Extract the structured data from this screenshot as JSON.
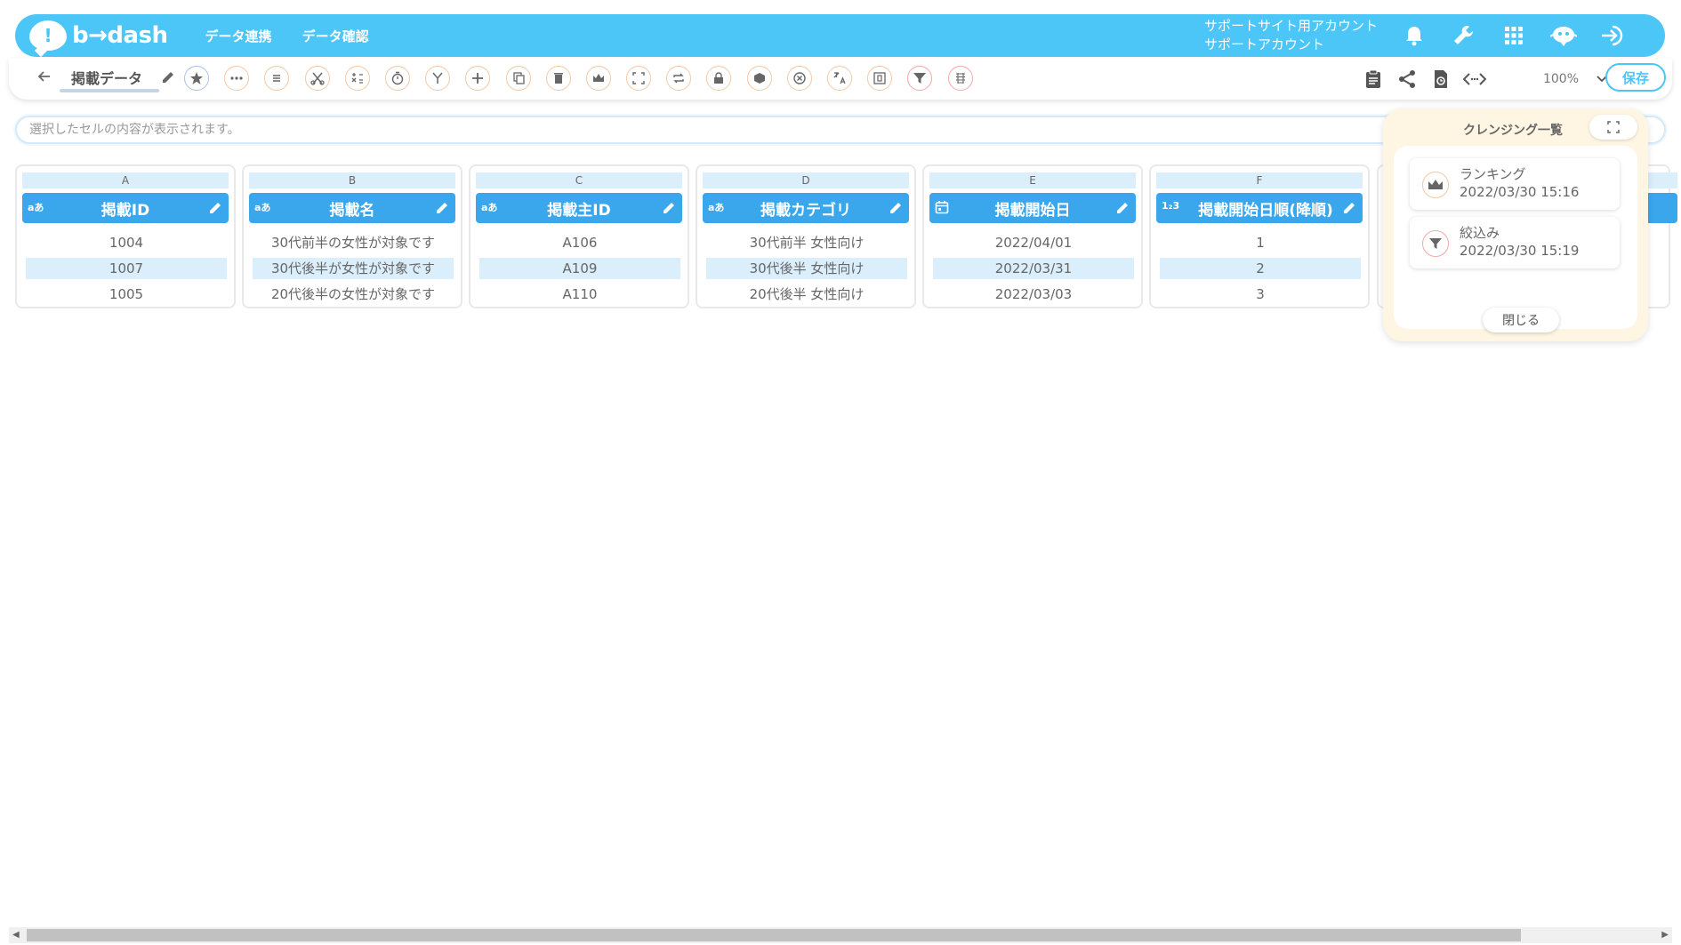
{
  "header": {
    "logo_text": "b→dash",
    "nav": [
      "データ連携",
      "データ確認"
    ],
    "account_line1": "サポートサイト用アカウント",
    "account_line2": "サポートアカウント",
    "icons": [
      "bell-icon",
      "wrench-icon",
      "grid-icon",
      "bot-icon",
      "logout-icon"
    ]
  },
  "toolbar": {
    "sheet_name": "掲載データ",
    "tools": [
      "star",
      "more",
      "list",
      "cut",
      "calc",
      "timer",
      "branch",
      "add",
      "copy",
      "delete",
      "ranking",
      "fullscreen",
      "repeat",
      "lock",
      "box",
      "close-circle",
      "translate",
      "frame",
      "filter",
      "pattern"
    ],
    "zoom": "100%",
    "save_label": "保存"
  },
  "cellbar": {
    "placeholder": "選択したセルの内容が表示されます。"
  },
  "columns": [
    {
      "letter": "A",
      "type": "aあ",
      "name": "掲載ID",
      "cells": [
        "1004",
        "1007",
        "1005"
      ]
    },
    {
      "letter": "B",
      "type": "aあ",
      "name": "掲載名",
      "cells": [
        "30代前半の女性が対象です",
        "30代後半が女性が対象です",
        "20代後半の女性が対象です"
      ]
    },
    {
      "letter": "C",
      "type": "aあ",
      "name": "掲載主ID",
      "cells": [
        "A106",
        "A109",
        "A110"
      ]
    },
    {
      "letter": "D",
      "type": "aあ",
      "name": "掲載カテゴリ",
      "cells": [
        "30代前半 女性向け",
        "30代後半 女性向け",
        "20代後半 女性向け"
      ]
    },
    {
      "letter": "E",
      "type": "date",
      "name": "掲載開始日",
      "cells": [
        "2022/04/01",
        "2022/03/31",
        "2022/03/03"
      ]
    },
    {
      "letter": "F",
      "type": "1₂3",
      "name": "掲載開始日順(降順)",
      "cells": [
        "1",
        "2",
        "3"
      ]
    }
  ],
  "panel": {
    "title": "クレンジング一覧",
    "history": [
      {
        "name": "ランキング",
        "time": "2022/03/30 15:16",
        "icon": "crown-icon"
      },
      {
        "name": "絞込み",
        "time": "2022/03/30 15:19",
        "icon": "filter-icon"
      }
    ],
    "close_label": "閉じる"
  }
}
